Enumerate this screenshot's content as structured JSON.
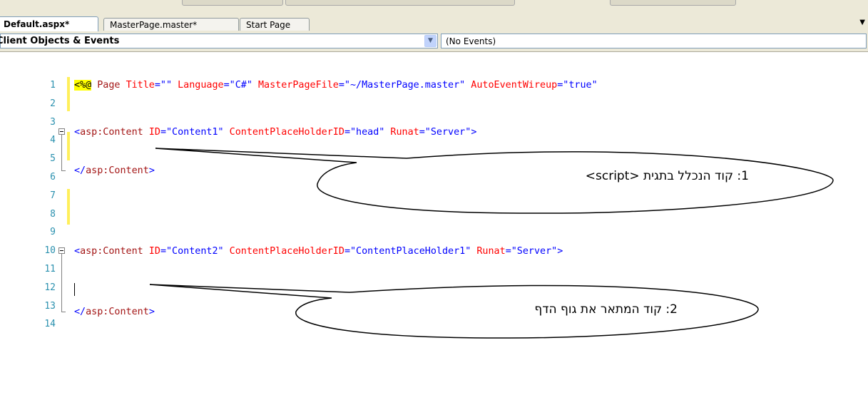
{
  "tabs": [
    {
      "label": "Default.aspx*",
      "active": true
    },
    {
      "label": "MasterPage.master*",
      "active": false
    },
    {
      "label": "Start Page",
      "active": false
    }
  ],
  "tab_dropdown_icon": "chevron-down-icon",
  "object_selector": {
    "value": "Client Objects & Events",
    "visible_value": "lient Objects & Events"
  },
  "event_selector": {
    "value": "(No Events)"
  },
  "line_numbers": [
    "1",
    "2",
    "3",
    "4",
    "5",
    "6",
    "7",
    "8",
    "9",
    "10",
    "11",
    "12",
    "13",
    "14"
  ],
  "code": {
    "line1": {
      "dir": "<%@",
      "page": " Page ",
      "a1": "Title",
      "eq1": "=\"\"",
      "a2": " Language",
      "eq2": "=\"C#\"",
      "a3": " MasterPageFile",
      "eq3": "=\"~/MasterPage.master\"",
      "a4": " AutoEventWireup",
      "eq4": "=\"true\""
    },
    "line3": {
      "open": "<",
      "tag": "asp:Content",
      "a1": " ID",
      "v1": "=\"Content1\"",
      "a2": " ContentPlaceHolderID",
      "v2": "=\"head\"",
      "a3": " Runat",
      "v3": "=\"Server\"",
      "close": ">"
    },
    "line5": {
      "open": "</",
      "tag": "asp:Content",
      "close": ">"
    },
    "line9": {
      "open": "<",
      "tag": "asp:Content",
      "a1": " ID",
      "v1": "=\"Content2\"",
      "a2": " ContentPlaceHolderID",
      "v2": "=\"ContentPlaceHolder1\"",
      "a3": " Runat",
      "v3": "=\"Server\"",
      "close": ">"
    },
    "line12": {
      "open": "</",
      "tag": "asp:Content",
      "close": ">"
    }
  },
  "callouts": [
    {
      "text": "1: קוד הנכלל בתגית    <script>"
    },
    {
      "text": "2: קוד המתאר את גוף הדף"
    }
  ],
  "colors": {
    "keyword": "#0000ff",
    "element": "#a31515",
    "attribute": "#ff0000",
    "line_number": "#2b91af",
    "directive_bg": "#ffff00",
    "change_marker": "#ffef5a"
  }
}
